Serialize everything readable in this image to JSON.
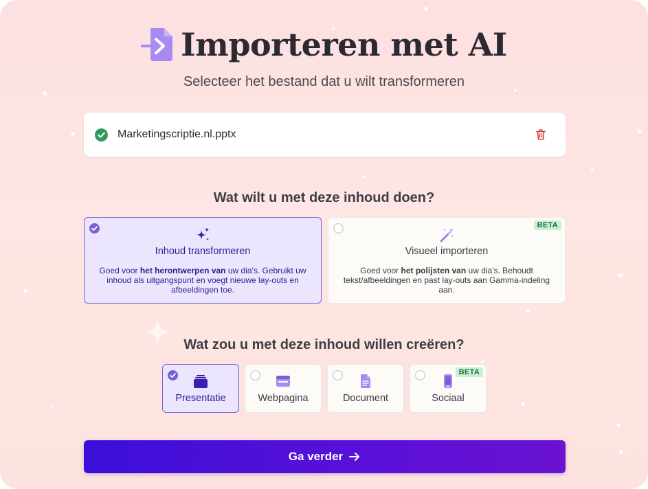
{
  "header": {
    "title": "Importeren met AI",
    "subtitle": "Selecteer het bestand dat u wilt transformeren"
  },
  "file": {
    "name": "Marketingscriptie.nl.pptx",
    "status": "uploaded"
  },
  "content_action": {
    "question": "Wat wilt u met deze inhoud doen?",
    "options": [
      {
        "label": "Inhoud transformeren",
        "selected": true,
        "icon": "sparkles-icon",
        "desc_pre": "Goed voor ",
        "desc_bold": "het herontwerpen van",
        "desc_post": " uw dia's. Gebruikt uw inhoud als uitgangspunt en voegt nieuwe lay-outs en afbeeldingen toe."
      },
      {
        "label": "Visueel importeren",
        "selected": false,
        "badge": "BETA",
        "icon": "magic-wand-icon",
        "desc_pre": "Goed voor ",
        "desc_bold": "het polijsten van",
        "desc_post": " uw dia's. Behoudt tekst/afbeeldingen en past lay-outs aan Gamma-indeling aan."
      }
    ]
  },
  "create_type": {
    "question": "Wat zou u met deze inhoud willen creëren?",
    "options": [
      {
        "label": "Presentatie",
        "selected": true,
        "icon": "presentation-icon"
      },
      {
        "label": "Webpagina",
        "selected": false,
        "icon": "webpage-icon"
      },
      {
        "label": "Document",
        "selected": false,
        "icon": "document-icon"
      },
      {
        "label": "Sociaal",
        "selected": false,
        "icon": "phone-icon",
        "badge": "BETA"
      }
    ]
  },
  "continue_button": {
    "label": "Ga verder"
  },
  "colors": {
    "accent": "#7a5fd6",
    "selected_bg": "#ebe5fd",
    "cta_start": "#3b0fd8",
    "cta_end": "#6a12d0",
    "success": "#2e9a5c",
    "danger": "#d63a3a",
    "beta_bg": "#c9f0d6"
  }
}
